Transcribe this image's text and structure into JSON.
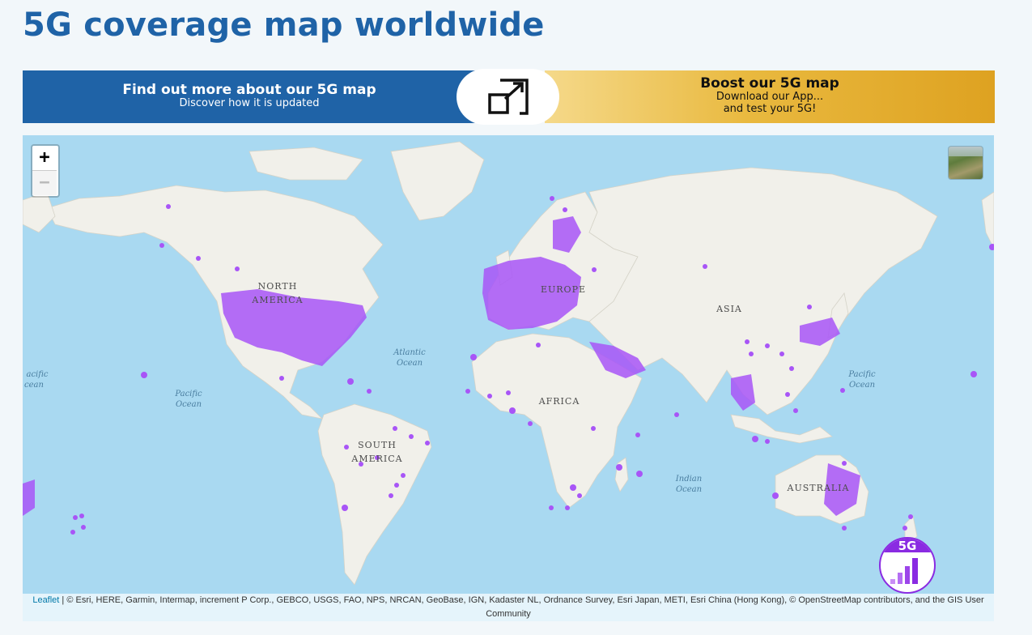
{
  "page": {
    "title": "5G coverage map worldwide"
  },
  "banner": {
    "left_title": "Find out more about our 5G map",
    "left_subtitle": "Discover how it is updated",
    "right_title": "Boost our 5G map",
    "right_line1": "Download our App...",
    "right_line2": "and test your 5G!",
    "expand_icon": "expand-icon"
  },
  "map": {
    "zoom_in": "+",
    "zoom_out": "−",
    "coverage_color": "#a855f7",
    "ocean_color": "#a8d8f0",
    "land_color": "#f2f1eb",
    "labels": {
      "north_america": [
        "NORTH",
        "AMERICA"
      ],
      "south_america": [
        "SOUTH",
        "AMERICA"
      ],
      "europe": "EUROPE",
      "asia": "ASIA",
      "africa": "AFRICA",
      "australia": "AUSTRALIA",
      "atlantic": [
        "Atlantic",
        "Ocean"
      ],
      "pacific_left": [
        "Pacific",
        "Ocean"
      ],
      "pacific_edge": [
        "acific",
        "cean"
      ],
      "pacific_right": [
        "Pacific",
        "Ocean"
      ],
      "indian": [
        "Indian",
        "Ocean"
      ]
    },
    "badge_label": "5G",
    "attribution_link": "Leaflet",
    "attribution_text": " | © Esri, HERE, Garmin, Intermap, increment P Corp., GEBCO, USGS, FAO, NPS, NRCAN, GeoBase, IGN, Kadaster NL, Ordnance Survey, Esri Japan, METI, Esri China (Hong Kong), © OpenStreetMap contributors, and the GIS User",
    "attribution_text2": "Community"
  }
}
